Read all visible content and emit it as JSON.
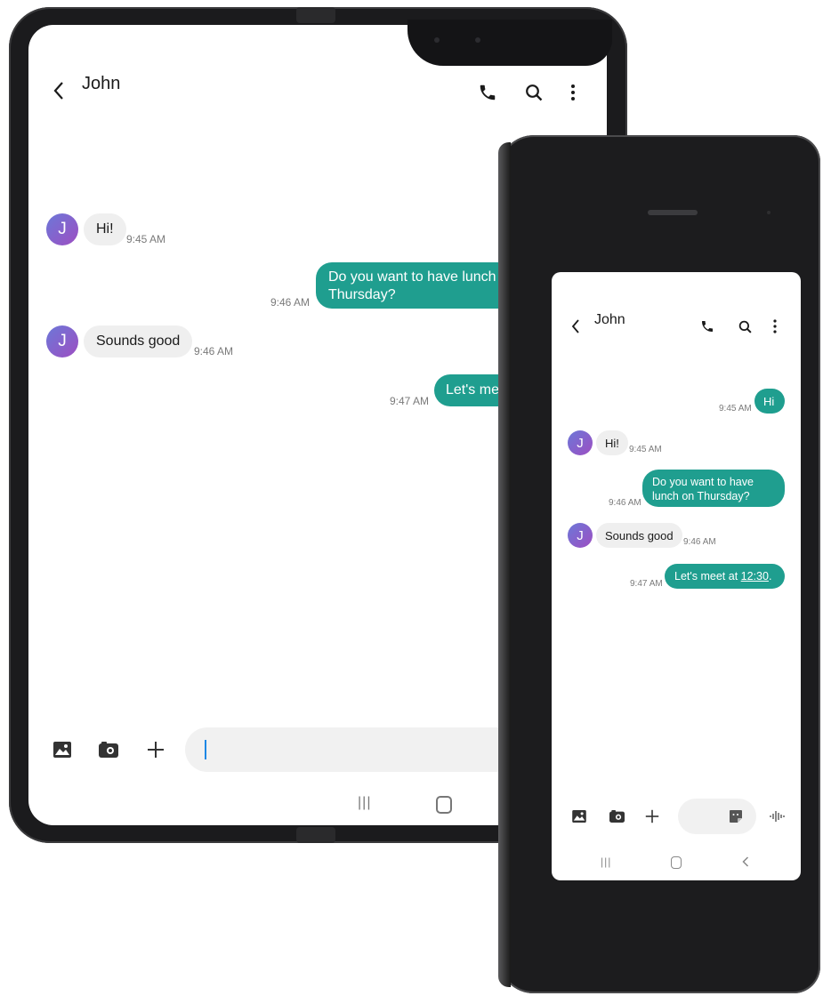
{
  "contact": {
    "name": "John",
    "initial": "J"
  },
  "icons": {
    "back": "chevron-left-icon",
    "call": "phone-icon",
    "search": "search-icon",
    "more": "more-vert-icon",
    "gallery": "gallery-icon",
    "camera": "camera-icon",
    "add": "plus-icon",
    "sticker": "sticker-icon",
    "voice": "voice-record-icon",
    "nav_recents": "recents-icon",
    "nav_home": "home-icon",
    "nav_back": "nav-back-icon"
  },
  "colors": {
    "accent": "#1f9e8f",
    "incoming": "#efefef",
    "frame": "#1b1b1d"
  },
  "big": {
    "messages": [
      {
        "dir": "in",
        "text": "Hi!",
        "time": "9:45 AM"
      },
      {
        "dir": "out",
        "text": "Do you want to have lunch on Thursday?",
        "visible_lines": [
          "Do you want to have lunch",
          "Thursday?"
        ],
        "time": "9:46 AM"
      },
      {
        "dir": "in",
        "text": "Sounds good",
        "time": "9:46 AM"
      },
      {
        "dir": "out",
        "text": "Let's me",
        "time": "9:47 AM"
      }
    ],
    "nav": {
      "recents": "|||"
    }
  },
  "small": {
    "messages": [
      {
        "dir": "out",
        "text": "Hi",
        "time": "9:45 AM"
      },
      {
        "dir": "in",
        "text": "Hi!",
        "time": "9:45 AM"
      },
      {
        "dir": "out",
        "lines": [
          "Do you want to have",
          "lunch on Thursday?"
        ],
        "time": "9:46 AM"
      },
      {
        "dir": "in",
        "text": "Sounds good",
        "time": "9:46 AM"
      },
      {
        "dir": "out",
        "text_pre": "Let's meet at ",
        "text_link": "12:30",
        "text_post": ".",
        "time": "9:47 AM"
      }
    ],
    "nav": {
      "recents": "|||"
    }
  }
}
